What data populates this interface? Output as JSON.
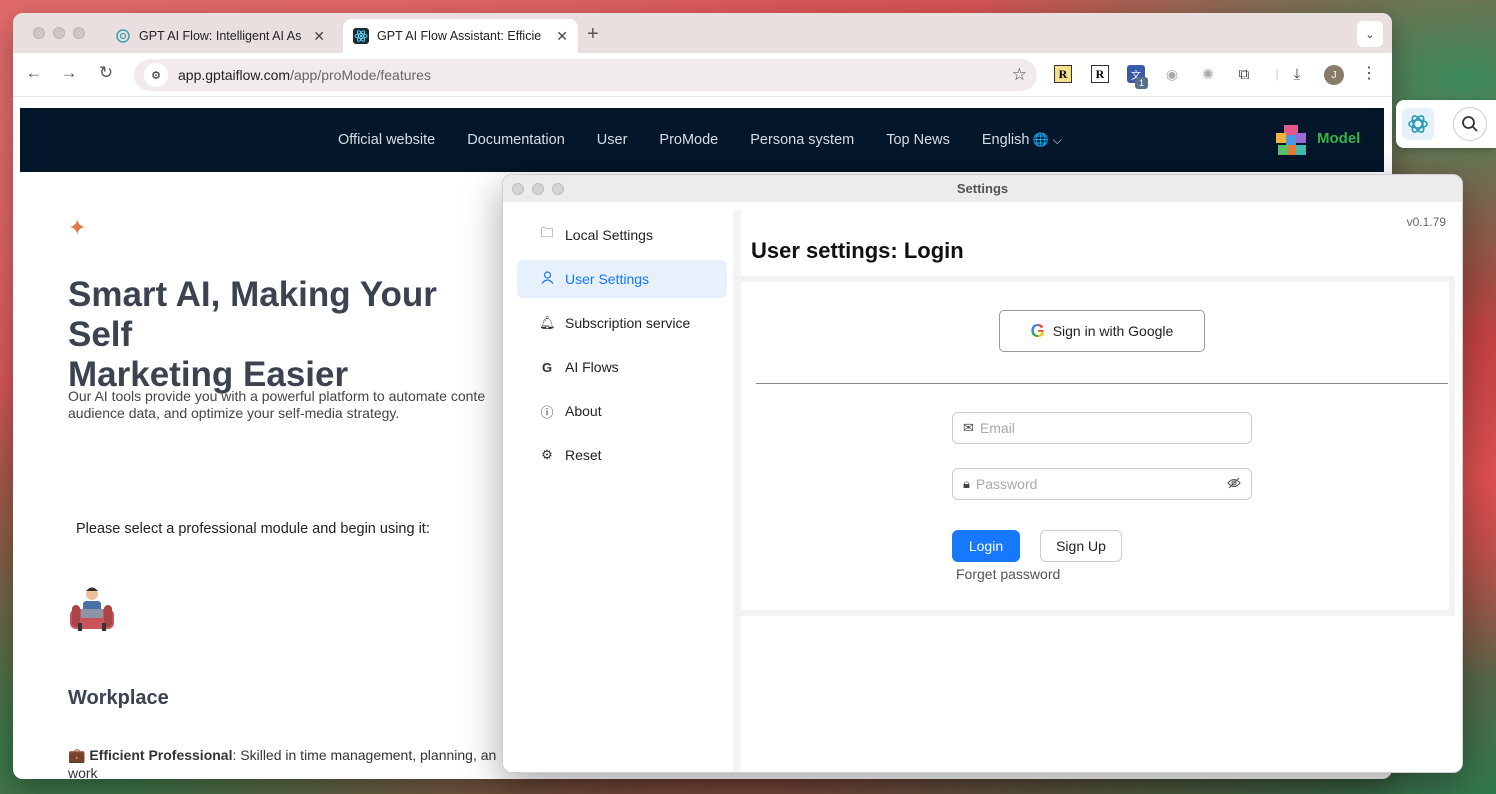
{
  "browser": {
    "tabs": [
      {
        "title": "GPT AI Flow: Intelligent AI As",
        "active": false,
        "favicon": "gpt-icon"
      },
      {
        "title": "GPT AI Flow Assistant: Efficie",
        "active": true,
        "favicon": "react-icon"
      }
    ],
    "new_tab": "+",
    "tab_search": "⌄",
    "address": {
      "host": "app.gptaiflow.com",
      "path": "/app/proMode/features"
    },
    "extensions": {
      "r1": "R",
      "r2": "R",
      "translate_badge": "1"
    },
    "profile_initial": "J"
  },
  "site": {
    "nav": [
      "Official website",
      "Documentation",
      "User",
      "ProMode",
      "Persona system",
      "Top News"
    ],
    "language": "English",
    "model_label": "Model",
    "hero_title": "Smart AI, Making Your Self Marketing Easier",
    "hero_title_line1": "Smart AI, Making Your Self",
    "hero_title_line2": "Marketing Easier",
    "hero_desc_line1": "Our AI tools provide you with a powerful platform to automate conte",
    "hero_desc_line2": "audience data, and optimize your self-media strategy.",
    "select_prompt": "Please select a professional module and begin using it:",
    "workplace_title": "Workplace",
    "efficient_label": "Efficient Professional",
    "efficient_text": ": Skilled in time management, planning, an",
    "efficient_text2": "work"
  },
  "settings": {
    "window_title": "Settings",
    "version": "v0.1.79",
    "sidebar": [
      {
        "label": "Local Settings",
        "icon": "folder-icon"
      },
      {
        "label": "User Settings",
        "icon": "user-icon",
        "selected": true
      },
      {
        "label": "Subscription service",
        "icon": "bell-icon"
      },
      {
        "label": "AI Flows",
        "icon": "google-g-icon"
      },
      {
        "label": "About",
        "icon": "info-icon"
      },
      {
        "label": "Reset",
        "icon": "gear-icon"
      }
    ],
    "title": "User settings: Login",
    "google_button": "Sign in with Google",
    "email_placeholder": "Email",
    "password_placeholder": "Password",
    "login_button": "Login",
    "signup_button": "Sign Up",
    "forget_password": "Forget password"
  },
  "colors": {
    "primary": "#1677ff",
    "nav_bg": "#04162a",
    "model_green": "#38b24a"
  }
}
